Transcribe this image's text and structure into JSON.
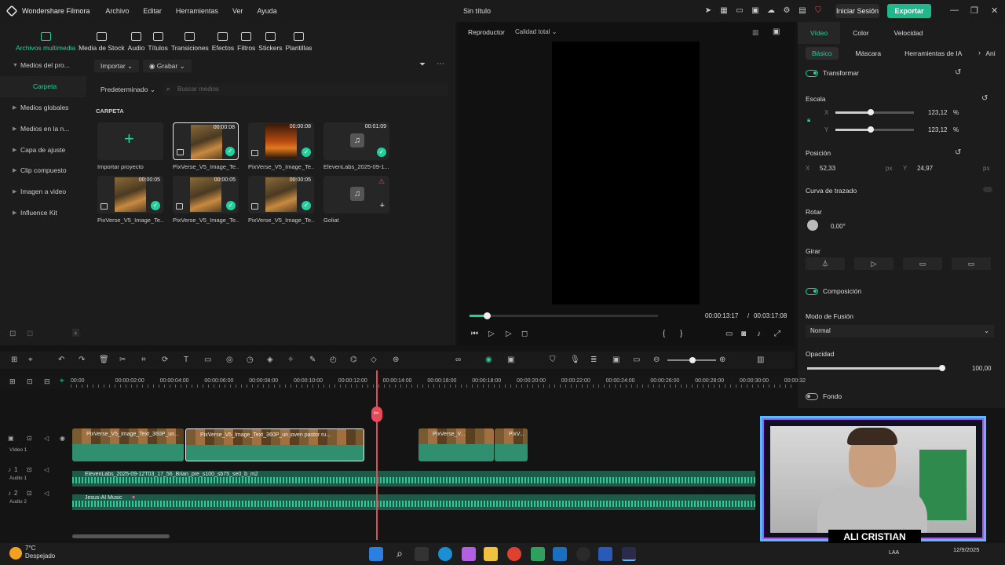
{
  "app": {
    "brand": "Wondershare Filmora",
    "title": "Sin título",
    "login": "Iniciar Sesión",
    "export": "Exportar"
  },
  "menu": [
    "Archivo",
    "Editar",
    "Herramientas",
    "Ver",
    "Ayuda"
  ],
  "lib_tabs": [
    "Archivos multimedia",
    "Media de Stock",
    "Audio",
    "Títulos",
    "Transiciones",
    "Efectos",
    "Filtros",
    "Stickers",
    "Plantillas"
  ],
  "sidebar": [
    "Medios del pro...",
    "Carpeta",
    "Medios globales",
    "Medios en la n...",
    "Capa de ajuste",
    "Clip compuesto",
    "Imagen a video",
    "Influence Kit"
  ],
  "media": {
    "import_btn": "Importar",
    "record_btn": "Grabar",
    "sort": "Predeterminado",
    "search_placeholder": "Buscar medios",
    "folder_label": "CARPETA",
    "items": [
      {
        "name": "Importar proyecto",
        "dur": ""
      },
      {
        "name": "PixVerse_V5_Image_Te...",
        "dur": "00:00:08"
      },
      {
        "name": "PixVerse_V5_Image_Te...",
        "dur": "00:00:08"
      },
      {
        "name": "ElevenLabs_2025-09-1...",
        "dur": "00:01:09"
      },
      {
        "name": "PixVerse_V5_Image_Te...",
        "dur": "00:00:05"
      },
      {
        "name": "PixVerse_V5_Image_Te...",
        "dur": "00:00:05"
      },
      {
        "name": "PixVerse_V5_Image_Te...",
        "dur": "00:00:05"
      },
      {
        "name": "Goliat",
        "dur": ""
      }
    ]
  },
  "preview": {
    "label": "Reproductor",
    "quality": "Calidad total",
    "current": "00:00:13:17",
    "sep": "/",
    "total": "00:03:17:08",
    "progress": 0.09
  },
  "props": {
    "tabs": [
      "Vídeo",
      "Color",
      "Velocidad"
    ],
    "subtabs": [
      "Básico",
      "Máscara",
      "Herramientas de IA",
      "Ani"
    ],
    "transform": "Transformar",
    "scale": {
      "label": "Escala",
      "x_label": "X",
      "y_label": "Y",
      "x": "123,12",
      "y": "123,12",
      "unit": "%",
      "x_level": 0.45,
      "y_level": 0.45
    },
    "position": {
      "label": "Posición",
      "x_label": "X",
      "x": "52,33",
      "y_label": "Y",
      "y": "24,97",
      "unit": "px"
    },
    "path": "Curva de trazado",
    "rotate": {
      "label": "Rotar",
      "value": "0,00°"
    },
    "flip": "Girar",
    "composition": "Composición",
    "blend": {
      "label": "Modo de Fusión",
      "value": "Normal"
    },
    "opacity": {
      "label": "Opacidad",
      "value": "100,00",
      "level": 1.0
    },
    "background": "Fondo"
  },
  "timeline": {
    "ruler": [
      "00:00",
      "00:00:02:00",
      "00:00:04:00",
      "00:00:06:00",
      "00:00:08:00",
      "00:00:10:00",
      "00:00:12:00",
      "00:00:14:00",
      "00:00:16:00",
      "00:00:18:00",
      "00:00:20:00",
      "00:00:22:00",
      "00:00:24:00",
      "00:00:26:00",
      "00:00:28:00",
      "00:00:30:00",
      "00:00:32"
    ],
    "tracks": [
      {
        "num": "1",
        "name": "Vídeo 1"
      },
      {
        "num": "1",
        "name": "Audio 1"
      },
      {
        "num": "2",
        "name": "Audio 2"
      }
    ],
    "video_clips": [
      "PixVerse_V5_Image_Text_360P_un...",
      "PixVerse_V5_Image_Text_360P_un joven pastor ru...",
      "PixVerse_V...",
      "PixV..."
    ],
    "audio1": "ElevenLabs_2025-09-12T03_17_56_Brian_pre_s100_sb75_se0_b_m2",
    "audio2": "Jesus-AI Music"
  },
  "webcam": {
    "name": "ALI CRISTIAN"
  },
  "taskbar": {
    "temp": "7°C",
    "weather": "Despejado",
    "lang": "LAA",
    "date": "12/9/2025"
  },
  "colors": {
    "accent": "#1fd19b",
    "playhead": "#e84a5a",
    "frame": "#5ab8ff"
  }
}
